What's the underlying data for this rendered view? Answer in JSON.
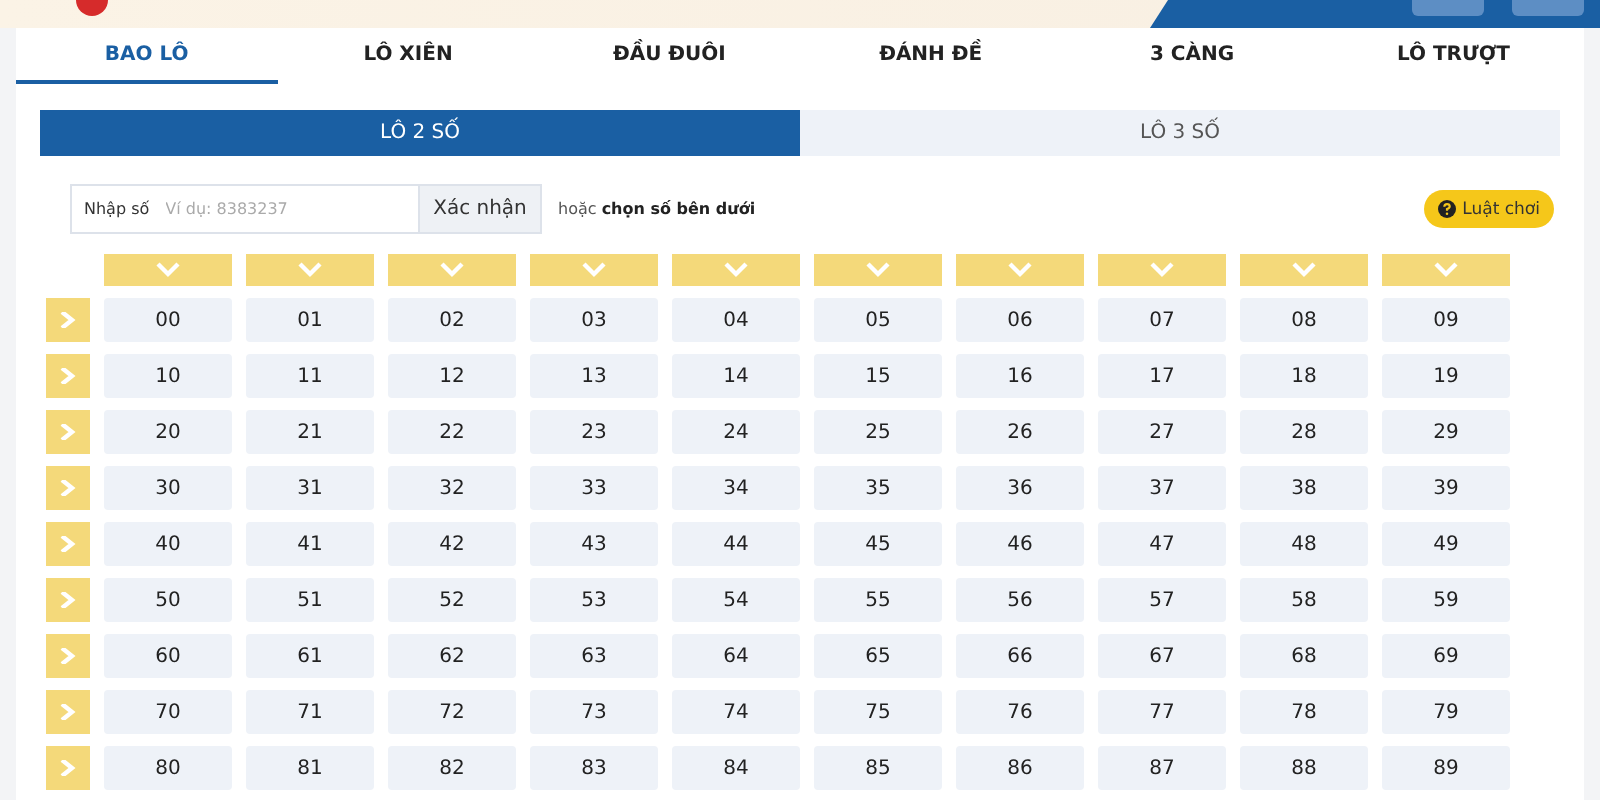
{
  "tabs": [
    {
      "label": "BAO LÔ",
      "selected": true
    },
    {
      "label": "LÔ XIÊN",
      "selected": false
    },
    {
      "label": "ĐẦU ĐUÔI",
      "selected": false
    },
    {
      "label": "ĐÁNH ĐỀ",
      "selected": false
    },
    {
      "label": "3 CÀNG",
      "selected": false
    },
    {
      "label": "LÔ TRƯỢT",
      "selected": false
    }
  ],
  "subtabs": [
    {
      "label": "LÔ 2 SỐ",
      "selected": true
    },
    {
      "label": "LÔ 3 SỐ",
      "selected": false
    }
  ],
  "number_input": {
    "label": "Nhập số",
    "placeholder": "Ví dụ: 8383237",
    "button": "Xác nhận"
  },
  "hint": "hoặc **chọn số bên dưới**",
  "rules_button": "Luật chơi",
  "grid": [
    [
      "00",
      "01",
      "02",
      "03",
      "04",
      "05",
      "06",
      "07",
      "08",
      "09"
    ],
    [
      "10",
      "11",
      "12",
      "13",
      "14",
      "15",
      "16",
      "17",
      "18",
      "19"
    ],
    [
      "20",
      "21",
      "22",
      "23",
      "24",
      "25",
      "26",
      "27",
      "28",
      "29"
    ],
    [
      "30",
      "31",
      "32",
      "33",
      "34",
      "35",
      "36",
      "37",
      "38",
      "39"
    ],
    [
      "40",
      "41",
      "42",
      "43",
      "44",
      "45",
      "46",
      "47",
      "48",
      "49"
    ],
    [
      "50",
      "51",
      "52",
      "53",
      "54",
      "55",
      "56",
      "57",
      "58",
      "59"
    ],
    [
      "60",
      "61",
      "62",
      "63",
      "64",
      "65",
      "66",
      "67",
      "68",
      "69"
    ],
    [
      "70",
      "71",
      "72",
      "73",
      "74",
      "75",
      "76",
      "77",
      "78",
      "79"
    ],
    [
      "80",
      "81",
      "82",
      "83",
      "84",
      "85",
      "86",
      "87",
      "88",
      "89"
    ]
  ]
}
